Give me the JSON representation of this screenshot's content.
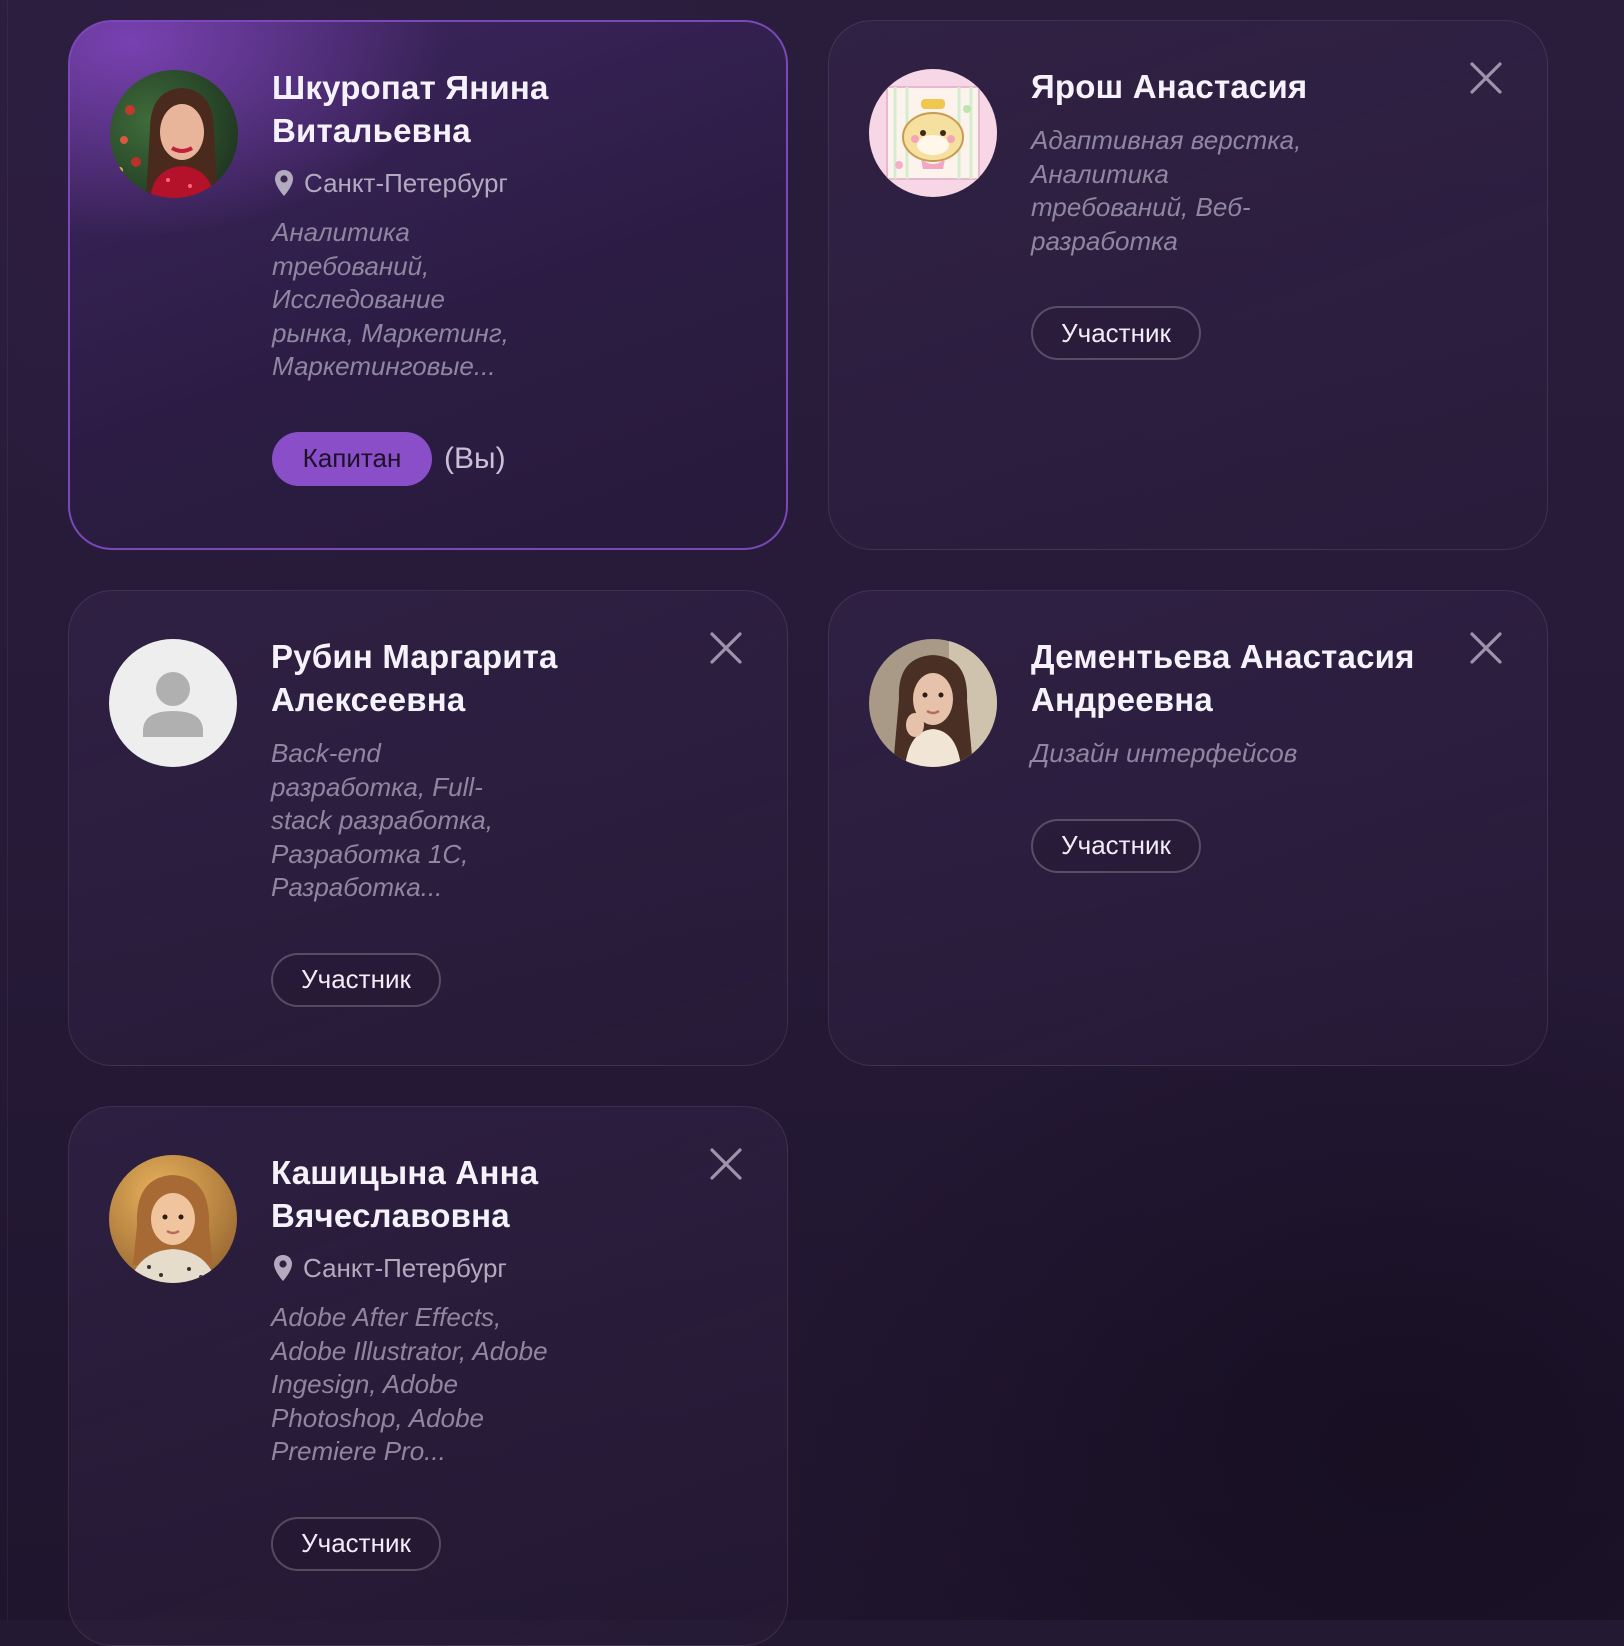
{
  "colors": {
    "background": "#231932",
    "captain_border": "#7a48b8",
    "captain_badge": "#8a4fc8",
    "skills_text": "#8f86a0",
    "location_text": "#b3aac0"
  },
  "members": [
    {
      "name": "Шкуропат Янина Витальевна",
      "location": "Санкт-Петербург",
      "skills": "Аналитика требований, Исследование рынка, Маркетинг, Маркетинговые...",
      "role": "Капитан",
      "self_marker": "(Вы)",
      "avatar_icon": "photo-avatar"
    },
    {
      "name": "Ярош Анастасия",
      "skills": "Адаптивная верстка, Аналитика требований, Веб-разработка",
      "role": "Участник",
      "avatar_icon": "cartoon-hamster-avatar",
      "remove_icon": "close-icon"
    },
    {
      "name": "Рубин Маргарита Алексеевна",
      "skills": "Back-end разработка, Full-stack разработка, Разработка 1С, Разработка...",
      "role": "Участник",
      "avatar_icon": "default-user-avatar",
      "remove_icon": "close-icon"
    },
    {
      "name": "Дементьева Анастасия Андреевна",
      "skills": "Дизайн интерфейсов",
      "role": "Участник",
      "avatar_icon": "photo-avatar",
      "remove_icon": "close-icon"
    },
    {
      "name": "Кашицына Анна Вячеславовна",
      "location": "Санкт-Петербург",
      "skills": "Adobe After Effects, Adobe Illustrator, Adobe Ingesign, Adobe Photoshop, Adobe Premiere Pro...",
      "role": "Участник",
      "avatar_icon": "photo-avatar",
      "remove_icon": "close-icon"
    }
  ]
}
